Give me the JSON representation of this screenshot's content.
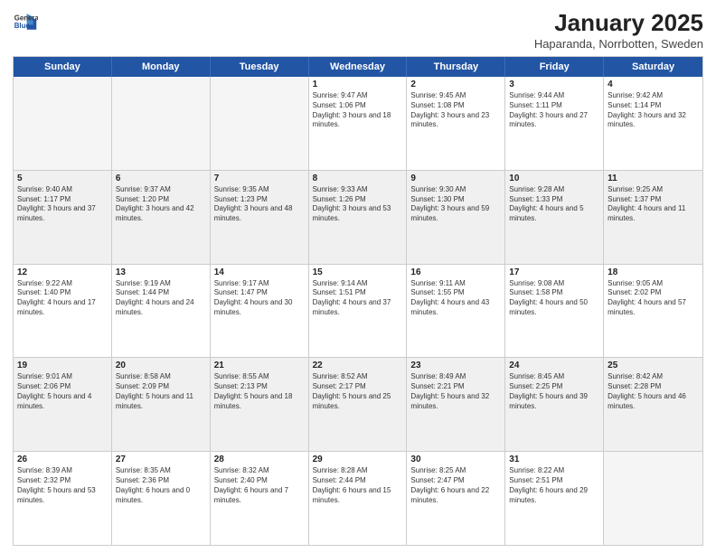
{
  "header": {
    "logo_line1": "General",
    "logo_line2": "Blue",
    "title": "January 2025",
    "subtitle": "Haparanda, Norrbotten, Sweden"
  },
  "weekdays": [
    "Sunday",
    "Monday",
    "Tuesday",
    "Wednesday",
    "Thursday",
    "Friday",
    "Saturday"
  ],
  "rows": [
    [
      {
        "day": "",
        "text": "",
        "empty": true
      },
      {
        "day": "",
        "text": "",
        "empty": true
      },
      {
        "day": "",
        "text": "",
        "empty": true
      },
      {
        "day": "1",
        "text": "Sunrise: 9:47 AM\nSunset: 1:06 PM\nDaylight: 3 hours and 18 minutes."
      },
      {
        "day": "2",
        "text": "Sunrise: 9:45 AM\nSunset: 1:08 PM\nDaylight: 3 hours and 23 minutes."
      },
      {
        "day": "3",
        "text": "Sunrise: 9:44 AM\nSunset: 1:11 PM\nDaylight: 3 hours and 27 minutes."
      },
      {
        "day": "4",
        "text": "Sunrise: 9:42 AM\nSunset: 1:14 PM\nDaylight: 3 hours and 32 minutes."
      }
    ],
    [
      {
        "day": "5",
        "text": "Sunrise: 9:40 AM\nSunset: 1:17 PM\nDaylight: 3 hours and 37 minutes.",
        "shaded": true
      },
      {
        "day": "6",
        "text": "Sunrise: 9:37 AM\nSunset: 1:20 PM\nDaylight: 3 hours and 42 minutes.",
        "shaded": true
      },
      {
        "day": "7",
        "text": "Sunrise: 9:35 AM\nSunset: 1:23 PM\nDaylight: 3 hours and 48 minutes.",
        "shaded": true
      },
      {
        "day": "8",
        "text": "Sunrise: 9:33 AM\nSunset: 1:26 PM\nDaylight: 3 hours and 53 minutes.",
        "shaded": true
      },
      {
        "day": "9",
        "text": "Sunrise: 9:30 AM\nSunset: 1:30 PM\nDaylight: 3 hours and 59 minutes.",
        "shaded": true
      },
      {
        "day": "10",
        "text": "Sunrise: 9:28 AM\nSunset: 1:33 PM\nDaylight: 4 hours and 5 minutes.",
        "shaded": true
      },
      {
        "day": "11",
        "text": "Sunrise: 9:25 AM\nSunset: 1:37 PM\nDaylight: 4 hours and 11 minutes.",
        "shaded": true
      }
    ],
    [
      {
        "day": "12",
        "text": "Sunrise: 9:22 AM\nSunset: 1:40 PM\nDaylight: 4 hours and 17 minutes."
      },
      {
        "day": "13",
        "text": "Sunrise: 9:19 AM\nSunset: 1:44 PM\nDaylight: 4 hours and 24 minutes."
      },
      {
        "day": "14",
        "text": "Sunrise: 9:17 AM\nSunset: 1:47 PM\nDaylight: 4 hours and 30 minutes."
      },
      {
        "day": "15",
        "text": "Sunrise: 9:14 AM\nSunset: 1:51 PM\nDaylight: 4 hours and 37 minutes."
      },
      {
        "day": "16",
        "text": "Sunrise: 9:11 AM\nSunset: 1:55 PM\nDaylight: 4 hours and 43 minutes."
      },
      {
        "day": "17",
        "text": "Sunrise: 9:08 AM\nSunset: 1:58 PM\nDaylight: 4 hours and 50 minutes."
      },
      {
        "day": "18",
        "text": "Sunrise: 9:05 AM\nSunset: 2:02 PM\nDaylight: 4 hours and 57 minutes."
      }
    ],
    [
      {
        "day": "19",
        "text": "Sunrise: 9:01 AM\nSunset: 2:06 PM\nDaylight: 5 hours and 4 minutes.",
        "shaded": true
      },
      {
        "day": "20",
        "text": "Sunrise: 8:58 AM\nSunset: 2:09 PM\nDaylight: 5 hours and 11 minutes.",
        "shaded": true
      },
      {
        "day": "21",
        "text": "Sunrise: 8:55 AM\nSunset: 2:13 PM\nDaylight: 5 hours and 18 minutes.",
        "shaded": true
      },
      {
        "day": "22",
        "text": "Sunrise: 8:52 AM\nSunset: 2:17 PM\nDaylight: 5 hours and 25 minutes.",
        "shaded": true
      },
      {
        "day": "23",
        "text": "Sunrise: 8:49 AM\nSunset: 2:21 PM\nDaylight: 5 hours and 32 minutes.",
        "shaded": true
      },
      {
        "day": "24",
        "text": "Sunrise: 8:45 AM\nSunset: 2:25 PM\nDaylight: 5 hours and 39 minutes.",
        "shaded": true
      },
      {
        "day": "25",
        "text": "Sunrise: 8:42 AM\nSunset: 2:28 PM\nDaylight: 5 hours and 46 minutes.",
        "shaded": true
      }
    ],
    [
      {
        "day": "26",
        "text": "Sunrise: 8:39 AM\nSunset: 2:32 PM\nDaylight: 5 hours and 53 minutes."
      },
      {
        "day": "27",
        "text": "Sunrise: 8:35 AM\nSunset: 2:36 PM\nDaylight: 6 hours and 0 minutes."
      },
      {
        "day": "28",
        "text": "Sunrise: 8:32 AM\nSunset: 2:40 PM\nDaylight: 6 hours and 7 minutes."
      },
      {
        "day": "29",
        "text": "Sunrise: 8:28 AM\nSunset: 2:44 PM\nDaylight: 6 hours and 15 minutes."
      },
      {
        "day": "30",
        "text": "Sunrise: 8:25 AM\nSunset: 2:47 PM\nDaylight: 6 hours and 22 minutes."
      },
      {
        "day": "31",
        "text": "Sunrise: 8:22 AM\nSunset: 2:51 PM\nDaylight: 6 hours and 29 minutes."
      },
      {
        "day": "",
        "text": "",
        "empty": true
      }
    ]
  ]
}
